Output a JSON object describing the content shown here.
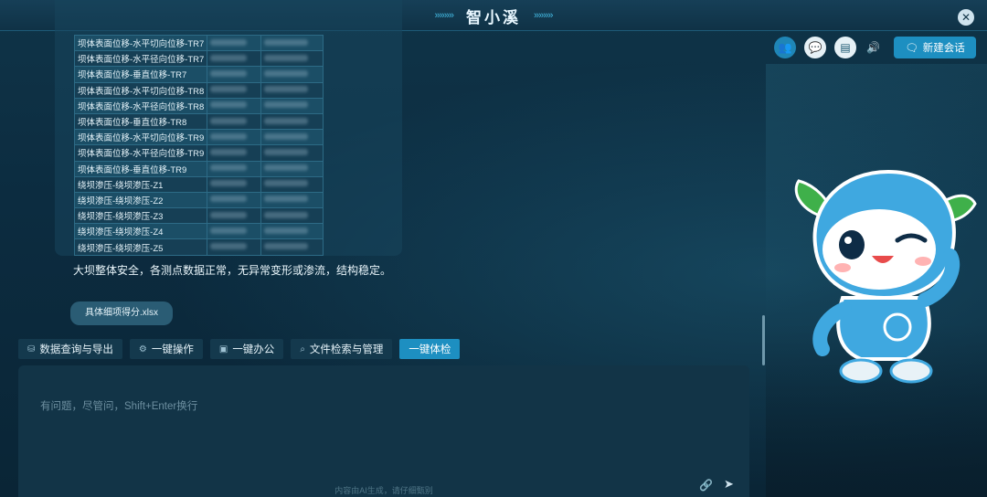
{
  "app": {
    "title": "智小溪",
    "title_deco_left": "»»»»",
    "title_deco_right": "»»»»",
    "close": "✕"
  },
  "table": {
    "rows": [
      {
        "label": "坝体表面位移-水平切向位移-TR7"
      },
      {
        "label": "坝体表面位移-水平径向位移-TR7"
      },
      {
        "label": "坝体表面位移-垂直位移-TR7"
      },
      {
        "label": "坝体表面位移-水平切向位移-TR8"
      },
      {
        "label": "坝体表面位移-水平径向位移-TR8"
      },
      {
        "label": "坝体表面位移-垂直位移-TR8"
      },
      {
        "label": "坝体表面位移-水平切向位移-TR9"
      },
      {
        "label": "坝体表面位移-水平径向位移-TR9"
      },
      {
        "label": "坝体表面位移-垂直位移-TR9"
      },
      {
        "label": "绕坝渗压-绕坝渗压-Z1"
      },
      {
        "label": "绕坝渗压-绕坝渗压-Z2"
      },
      {
        "label": "绕坝渗压-绕坝渗压-Z3"
      },
      {
        "label": "绕坝渗压-绕坝渗压-Z4"
      },
      {
        "label": "绕坝渗压-绕坝渗压-Z5"
      }
    ]
  },
  "message": {
    "summary": "大坝整体安全，各测点数据正常，无异常变形或渗流，结构稳定。"
  },
  "file": {
    "name": "具体细项得分.xlsx"
  },
  "actions": [
    {
      "label": "数据查询与导出",
      "icon": "⛁"
    },
    {
      "label": "一键操作",
      "icon": "⚙"
    },
    {
      "label": "一键办公",
      "icon": "▣"
    },
    {
      "label": "文件检索与管理",
      "icon": "⌕"
    },
    {
      "label": "一键体检",
      "icon": ""
    }
  ],
  "input": {
    "placeholder": "有问题，尽管问，Shift+Enter换行",
    "disclaimer": "内容由AI生成，请仔细甄别"
  },
  "tools": {
    "new_chat": "新建会话"
  },
  "colors": {
    "accent": "#1d8fc1",
    "panel": "#123447"
  }
}
